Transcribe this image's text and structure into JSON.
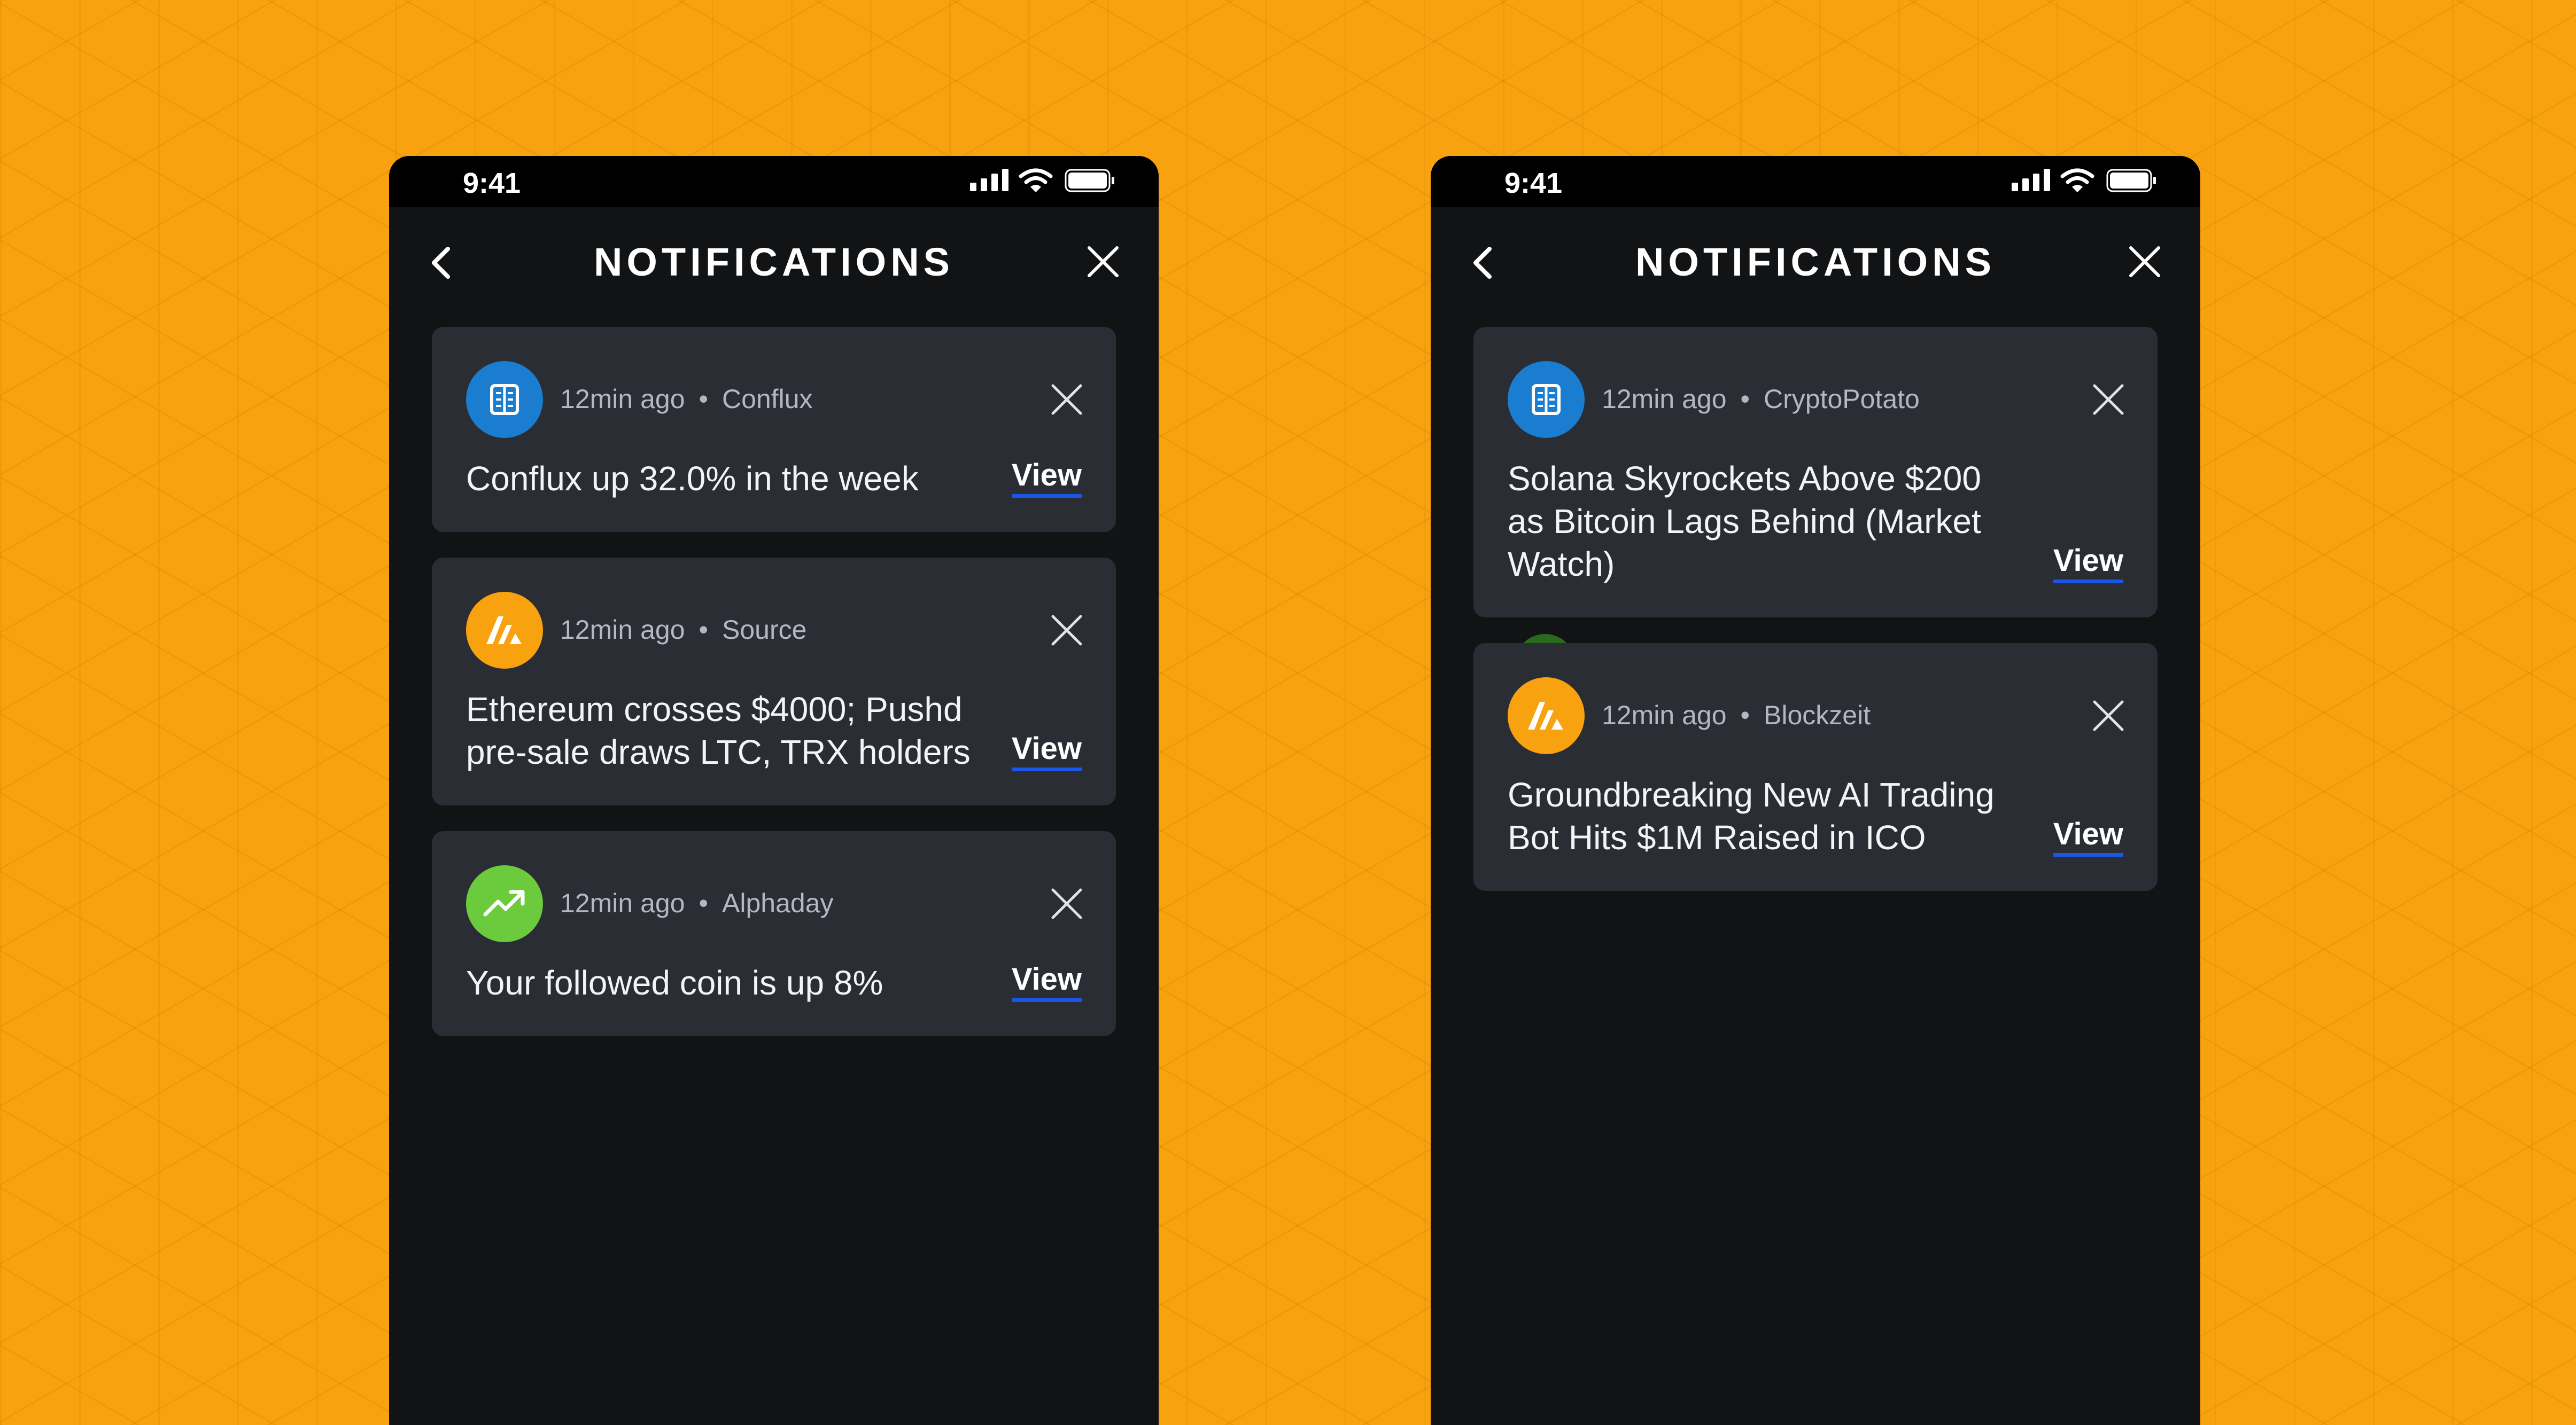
{
  "screens": [
    {
      "status_time": "9:41",
      "header": {
        "title": "NOTIFICATIONS"
      },
      "notifications": [
        {
          "icon": "newspaper-icon",
          "time": "12min ago",
          "source": "Conflux",
          "headline": "Conflux up 32.0% in the week",
          "action": "View"
        },
        {
          "icon": "source-logo-icon",
          "time": "12min ago",
          "source": "Source",
          "headline": "Ethereum crosses $4000; Pushd pre-sale draws LTC, TRX holders",
          "action": "View"
        },
        {
          "icon": "trending-up-icon",
          "time": "12min ago",
          "source": "Alphaday",
          "headline": "Your followed coin is up 8%",
          "action": "View"
        }
      ]
    },
    {
      "status_time": "9:41",
      "header": {
        "title": "NOTIFICATIONS"
      },
      "notifications": [
        {
          "icon": "newspaper-icon",
          "time": "12min ago",
          "source": "CryptoPotato",
          "headline": "Solana Skyrockets Above $200 as Bitcoin Lags Behind (Market Watch)",
          "action": "View"
        },
        {
          "icon": "source-logo-icon",
          "time": "12min ago",
          "source": "Blockzeit",
          "headline": "Groundbreaking New AI Trading Bot Hits $1M Raised in ICO",
          "action": "View"
        }
      ]
    }
  ],
  "separator": "•",
  "colors": {
    "background": "#f9a20f",
    "phone": "#121315",
    "card": "#2b2d35",
    "link_underline": "#1a57e6",
    "icon_blue": "#1a7dd0",
    "icon_orange": "#f9a20f",
    "icon_green": "#6ccb3d"
  }
}
